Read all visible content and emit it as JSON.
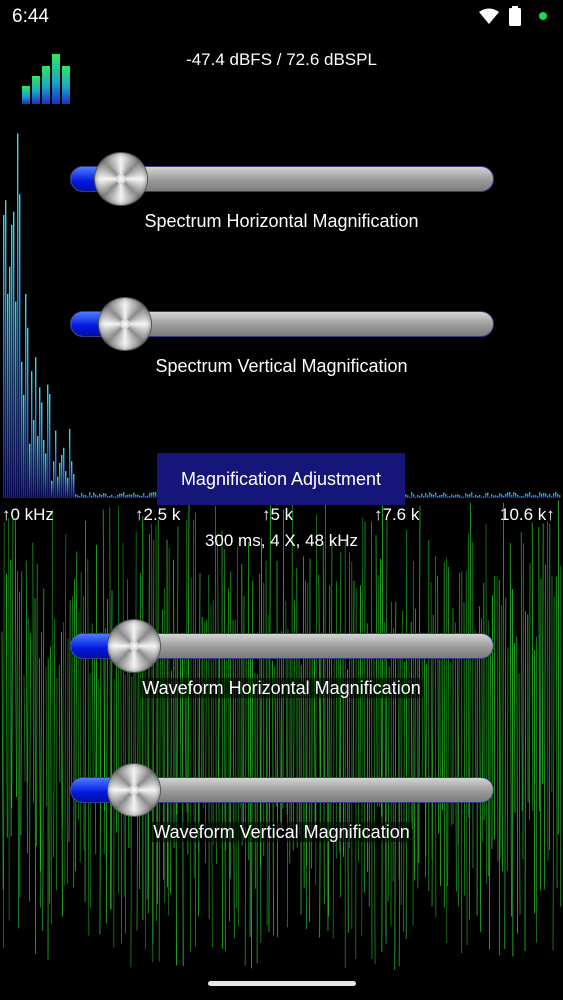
{
  "status_bar": {
    "time": "6:44",
    "icons": [
      "wifi-icon",
      "battery-icon"
    ],
    "dot_color": "#1ed760"
  },
  "readout": {
    "level": "-47.4 dBFS / 72.6 dBSPL"
  },
  "spectrum": {
    "freq_labels": [
      "↑0 kHz",
      "↑2.5 k",
      "↑5 k",
      "↑7.6 k",
      "10.6 k↑"
    ]
  },
  "sample_info": "300 ms, 4 X, 48 kHz",
  "dialog": {
    "title": "Magnification Adjustment",
    "sliders": [
      {
        "label": "Spectrum Horizontal Magnification",
        "value": 0.12
      },
      {
        "label": "Spectrum Vertical Magnification",
        "value": 0.13
      },
      {
        "label": "Waveform Horizontal Magnification",
        "value": 0.15
      },
      {
        "label": "Waveform Vertical Magnification",
        "value": 0.15
      }
    ]
  },
  "colors": {
    "spectrum_top": "#37e0e8",
    "spectrum_bottom": "#1515d0",
    "waveform": "#2ed62e",
    "dialog_bg": "#16167a",
    "slider_fill": "#0018e0"
  }
}
